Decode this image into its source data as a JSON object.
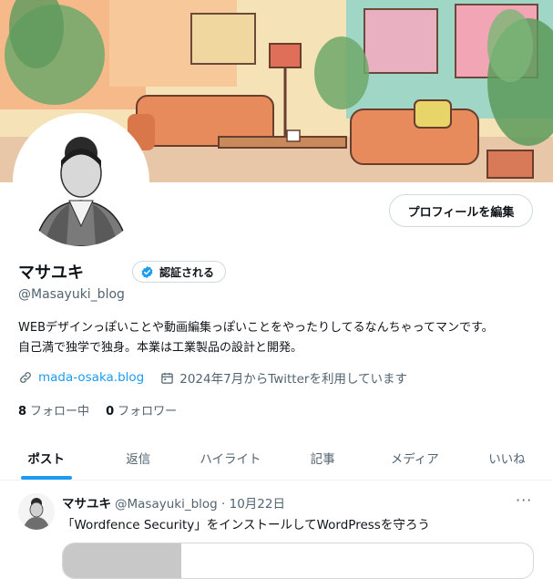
{
  "profile": {
    "edit_label": "プロフィールを編集",
    "name": "マサユキ",
    "verified_label": "認証される",
    "handle": "@Masayuki_blog",
    "bio_line1": "WEBデザインっぽいことや動画編集っぽいことをやったりしてるなんちゃってマンです。",
    "bio_line2": "自己満で独学で独身。本業は工業製品の設計と開発。",
    "link_text": "mada-osaka.blog",
    "joined_text": "2024年7月からTwitterを利用しています",
    "following_count": "8",
    "following_label": "フォロー中",
    "followers_count": "0",
    "followers_label": "フォロワー"
  },
  "tabs": [
    {
      "label": "ポスト",
      "active": true
    },
    {
      "label": "返信"
    },
    {
      "label": "ハイライト"
    },
    {
      "label": "記事"
    },
    {
      "label": "メディア"
    },
    {
      "label": "いいね"
    }
  ],
  "post": {
    "name": "マサユキ",
    "meta": "@Masayuki_blog · 10月22日",
    "more": "···",
    "text": "「Wordfence Security」をインストールしてWordPressを守ろう"
  },
  "colors": {
    "accent": "#1d9bf0",
    "text": "#0f1419",
    "muted": "#536471",
    "verified_badge": "#1d9bf0"
  },
  "icons": {
    "verified": "verified-badge-icon",
    "link": "link-icon",
    "calendar": "calendar-icon",
    "more": "more-dots-icon"
  }
}
